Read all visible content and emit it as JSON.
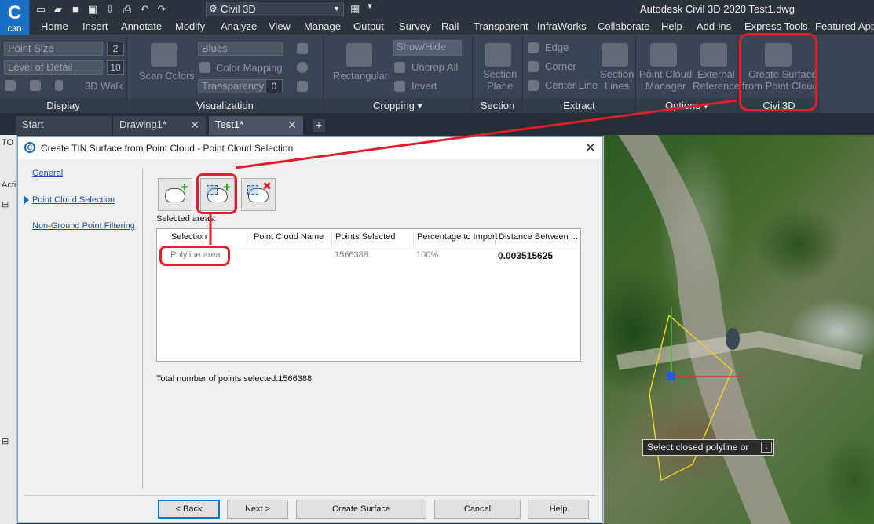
{
  "app": {
    "logo": "C",
    "logo_sub": "C3D",
    "workspace": "Civil 3D",
    "title": "Autodesk Civil 3D 2020   Test1.dwg"
  },
  "ribbon_tabs": [
    "Home",
    "Insert",
    "Annotate",
    "Modify",
    "Analyze",
    "View",
    "Manage",
    "Output",
    "Survey",
    "Rail",
    "Transparent",
    "InfraWorks",
    "Collaborate",
    "Help",
    "Add-ins",
    "Express Tools",
    "Featured Apps"
  ],
  "ribbon": {
    "display": {
      "title": "Display",
      "point_size_label": "Point Size",
      "point_size_value": "2",
      "lod_label": "Level of Detail",
      "lod_value": "10",
      "walk_label": "3D Walk"
    },
    "visualization": {
      "title": "Visualization",
      "scan_colors": "Scan Colors",
      "color_scheme": "Blues",
      "color_mapping": "Color Mapping",
      "transparency_label": "Transparency",
      "transparency_value": "0"
    },
    "cropping": {
      "title": "Cropping",
      "rectangular": "Rectangular",
      "show_hide": "Show/Hide",
      "uncrop_all": "Uncrop All",
      "invert": "Invert"
    },
    "section": {
      "title": "Section",
      "section_plane_1": "Section",
      "section_plane_2": "Plane"
    },
    "extract": {
      "title": "Extract",
      "edge": "Edge",
      "corner": "Corner",
      "center_line": "Center Line",
      "section_lines_1": "Section",
      "section_lines_2": "Lines"
    },
    "options": {
      "title": "Options",
      "pcm_1": "Point Cloud",
      "pcm_2": "Manager",
      "ext_ref_1": "External",
      "ext_ref_2": "Reference"
    },
    "civil3d": {
      "title": "Civil3D",
      "create_surface_1": "Create Surface",
      "create_surface_2": "from Point Cloud"
    }
  },
  "doc_tabs": [
    {
      "label": "Start"
    },
    {
      "label": "Drawing1*"
    },
    {
      "label": "Test1*"
    }
  ],
  "left_strip": {
    "top_label": "TO",
    "mid_label": "Acti"
  },
  "dialog": {
    "title": "Create TIN Surface from Point Cloud - Point Cloud Selection",
    "nav": [
      "General",
      "Point Cloud Selection",
      "Non-Ground Point Filtering"
    ],
    "selected_areas_label": "Selected areas:",
    "columns": [
      "Selection",
      "Point Cloud Name",
      "Points Selected",
      "Percentage to Import",
      "Distance Between ..."
    ],
    "rows": [
      {
        "selection": "Polyline area",
        "name": "",
        "points": "1566388",
        "percentage": "100%",
        "distance": "0.003515625"
      }
    ],
    "total": "Total number of points selected:1566388",
    "buttons": {
      "back": "< Back",
      "next": "Next >",
      "create": "Create Surface",
      "cancel": "Cancel",
      "help": "Help"
    }
  },
  "prompt": "Select closed polyline or",
  "colors": {
    "highlight": "#e01f2a",
    "brand": "#1a6fc4",
    "ribbon_bg": "#3b4452"
  }
}
